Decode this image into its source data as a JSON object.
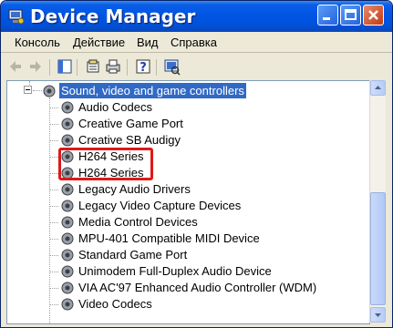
{
  "window": {
    "title": "Device Manager"
  },
  "menu": {
    "items": [
      "Консоль",
      "Действие",
      "Вид",
      "Справка"
    ]
  },
  "toolbar": {
    "icons": [
      "back-icon",
      "forward-icon",
      "show-hide-tree-icon",
      "properties-icon",
      "print-icon",
      "help-icon",
      "scan-hardware-icon"
    ]
  },
  "tree": {
    "category": "Sound, video and game controllers",
    "devices": [
      "Audio Codecs",
      "Creative Game Port",
      "Creative SB Audigy",
      "H264 Series",
      "H264 Series",
      "Legacy Audio Drivers",
      "Legacy Video Capture Devices",
      "Media Control Devices",
      "MPU-401 Compatible MIDI Device",
      "Standard Game Port",
      "Unimodem Full-Duplex Audio Device",
      "VIA AC'97 Enhanced Audio Controller (WDM)",
      "Video Codecs"
    ]
  },
  "colors": {
    "selection": "#316ac5",
    "highlight_box": "#e01818",
    "titlebar": "#0055e5"
  }
}
